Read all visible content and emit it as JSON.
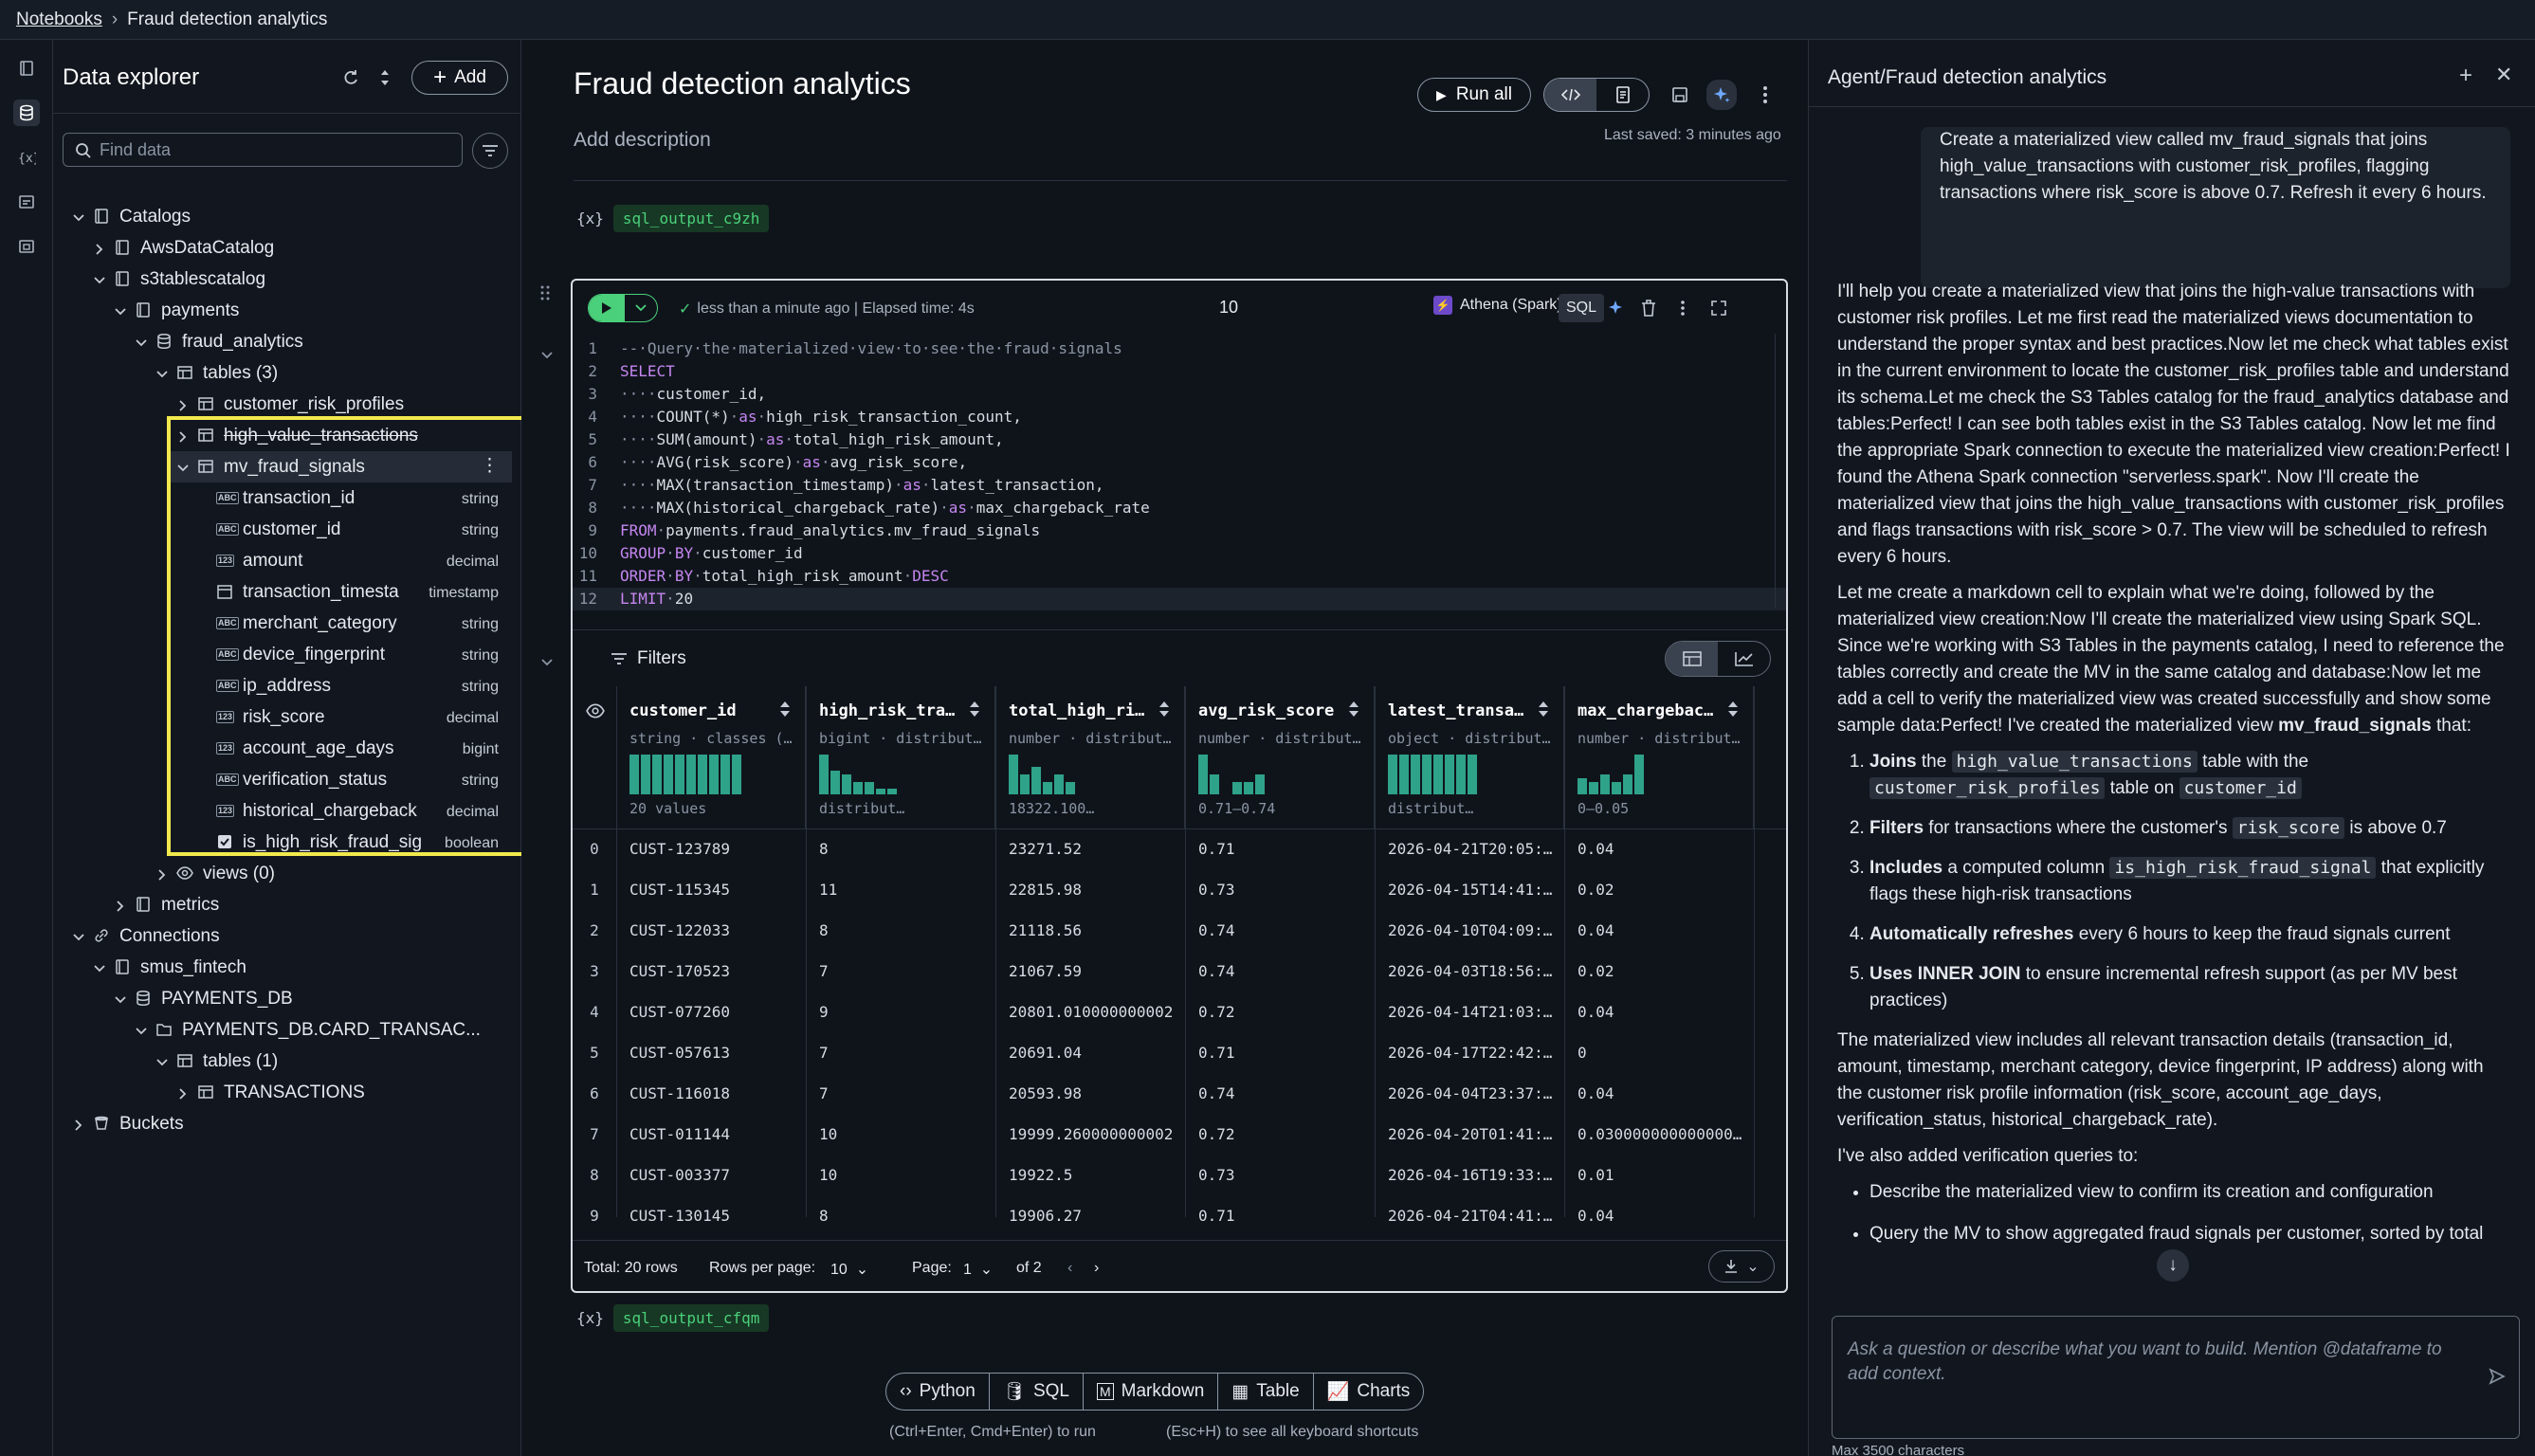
{
  "topbar": {
    "crumb_root": "Notebooks",
    "crumb_current": "Fraud detection analytics"
  },
  "explorer": {
    "title": "Data explorer",
    "add_label": "Add",
    "search_placeholder": "Find data",
    "tree": [
      {
        "label": "Catalogs",
        "icon": "book-icon"
      },
      {
        "label": "AwsDataCatalog",
        "icon": "book-icon"
      },
      {
        "label": "s3tablescatalog",
        "icon": "book-icon"
      },
      {
        "label": "payments",
        "icon": "book-icon"
      },
      {
        "label": "fraud_analytics",
        "icon": "database-icon"
      },
      {
        "label": "tables (3)",
        "icon": "table-icon"
      },
      {
        "label": "customer_risk_profiles",
        "icon": "table-icon"
      },
      {
        "label": "high_value_transactions",
        "icon": "table-icon"
      },
      {
        "label": "mv_fraud_signals",
        "icon": "table-icon"
      },
      {
        "label": "transaction_id",
        "type": "string",
        "badge": "ABC"
      },
      {
        "label": "customer_id",
        "type": "string",
        "badge": "ABC"
      },
      {
        "label": "amount",
        "type": "decimal",
        "badge": "123"
      },
      {
        "label": "transaction_timesta",
        "type": "timestamp",
        "badge": "cal"
      },
      {
        "label": "merchant_category",
        "type": "string",
        "badge": "ABC"
      },
      {
        "label": "device_fingerprint",
        "type": "string",
        "badge": "ABC"
      },
      {
        "label": "ip_address",
        "type": "string",
        "badge": "ABC"
      },
      {
        "label": "risk_score",
        "type": "decimal",
        "badge": "123"
      },
      {
        "label": "account_age_days",
        "type": "bigint",
        "badge": "123"
      },
      {
        "label": "verification_status",
        "type": "string",
        "badge": "ABC"
      },
      {
        "label": "historical_chargeback",
        "type": "decimal",
        "badge": "123"
      },
      {
        "label": "is_high_risk_fraud_sig",
        "type": "boolean",
        "badge": "chk"
      },
      {
        "label": "views (0)",
        "icon": "eye-icon"
      },
      {
        "label": "metrics",
        "icon": "book-icon"
      },
      {
        "label": "Connections",
        "icon": "link-icon"
      },
      {
        "label": "smus_fintech",
        "icon": "book-icon"
      },
      {
        "label": "PAYMENTS_DB",
        "icon": "database-icon"
      },
      {
        "label": "PAYMENTS_DB.CARD_TRANSAC...",
        "icon": "folder-icon"
      },
      {
        "label": "tables (1)",
        "icon": "table-icon"
      },
      {
        "label": "TRANSACTIONS",
        "icon": "table-icon"
      },
      {
        "label": "Buckets",
        "icon": "bucket-icon"
      }
    ]
  },
  "notebook": {
    "title": "Fraud detection analytics",
    "description": "Add description",
    "run_all": "Run all",
    "last_saved": "Last saved: 3 minutes ago",
    "var_above": "sql_output_c9zh",
    "var_below": "sql_output_cfqm",
    "var_brace": "{x}"
  },
  "cell": {
    "status": "less than a minute ago | Elapsed time: 4s",
    "limit": "10",
    "connection": "Athena (Spark)",
    "language": "SQL",
    "code": [
      {
        "n": "1",
        "t": "-- Query the materialized view to see the fraud signals"
      },
      {
        "n": "2",
        "t": "SELECT"
      },
      {
        "n": "3",
        "t": "    customer_id,"
      },
      {
        "n": "4",
        "t": "    COUNT(*) as high_risk_transaction_count,"
      },
      {
        "n": "5",
        "t": "    SUM(amount) as total_high_risk_amount,"
      },
      {
        "n": "6",
        "t": "    AVG(risk_score) as avg_risk_score,"
      },
      {
        "n": "7",
        "t": "    MAX(transaction_timestamp) as latest_transaction,"
      },
      {
        "n": "8",
        "t": "    MAX(historical_chargeback_rate) as max_chargeback_rate"
      },
      {
        "n": "9",
        "t": "FROM payments.fraud_analytics.mv_fraud_signals"
      },
      {
        "n": "10",
        "t": "GROUP BY customer_id"
      },
      {
        "n": "11",
        "t": "ORDER BY total_high_risk_amount DESC"
      },
      {
        "n": "12",
        "t": "LIMIT 20"
      }
    ],
    "filters_label": "Filters",
    "columns": [
      {
        "name": "customer_id",
        "sub": "string · classes (…",
        "cap": "20 values",
        "hist": [
          1,
          1,
          1,
          1,
          1,
          1,
          1,
          1,
          1,
          1
        ]
      },
      {
        "name": "high_risk_tra…",
        "sub": "bigint · distribut…",
        "cap": "distribut…",
        "hist": [
          1,
          0.6,
          0.5,
          0.3,
          0.3,
          0.15,
          0.15
        ]
      },
      {
        "name": "total_high_ri…",
        "sub": "number · distribut…",
        "cap": "18322.100…",
        "hist": [
          1,
          0.5,
          0.7,
          0.3,
          0.5,
          0.3
        ]
      },
      {
        "name": "avg_risk_score",
        "sub": "number · distribut…",
        "cap": "0.71–0.74",
        "hist": [
          1,
          0.5,
          0,
          0.3,
          0.3,
          0.5
        ]
      },
      {
        "name": "latest_transa…",
        "sub": "object · distribut…",
        "cap": "distribut…",
        "hist": [
          1,
          1,
          1,
          1,
          1,
          1,
          1,
          1
        ]
      },
      {
        "name": "max_chargebac…",
        "sub": "number · distribut…",
        "cap": "0–0.05",
        "hist": [
          0.4,
          0.3,
          0.5,
          0.3,
          0.5,
          1
        ]
      }
    ],
    "rows": [
      [
        "0",
        "CUST-123789",
        "8",
        "23271.52",
        "0.71",
        "2026-04-21T20:05:…",
        "0.04"
      ],
      [
        "1",
        "CUST-115345",
        "11",
        "22815.98",
        "0.73",
        "2026-04-15T14:41:…",
        "0.02"
      ],
      [
        "2",
        "CUST-122033",
        "8",
        "21118.56",
        "0.74",
        "2026-04-10T04:09:…",
        "0.04"
      ],
      [
        "3",
        "CUST-170523",
        "7",
        "21067.59",
        "0.74",
        "2026-04-03T18:56:…",
        "0.02"
      ],
      [
        "4",
        "CUST-077260",
        "9",
        "20801.010000000002",
        "0.72",
        "2026-04-14T21:03:…",
        "0.04"
      ],
      [
        "5",
        "CUST-057613",
        "7",
        "20691.04",
        "0.71",
        "2026-04-17T22:42:…",
        "0"
      ],
      [
        "6",
        "CUST-116018",
        "7",
        "20593.98",
        "0.74",
        "2026-04-04T23:37:…",
        "0.04"
      ],
      [
        "7",
        "CUST-011144",
        "10",
        "19999.260000000002",
        "0.72",
        "2026-04-20T01:41:…",
        "0.030000000000000…"
      ],
      [
        "8",
        "CUST-003377",
        "10",
        "19922.5",
        "0.73",
        "2026-04-16T19:33:…",
        "0.01"
      ],
      [
        "9",
        "CUST-130145",
        "8",
        "19906.27",
        "0.71",
        "2026-04-21T04:41:…",
        "0.04"
      ]
    ],
    "pager": {
      "total": "Total: 20 rows",
      "rpp_label": "Rows per page:",
      "rpp": "10",
      "page_label": "Page:",
      "page": "1",
      "of": "of 2"
    }
  },
  "add_cell": {
    "python": "Python",
    "sql": "SQL",
    "markdown": "Markdown",
    "table": "Table",
    "charts": "Charts"
  },
  "hints": {
    "run": "(Ctrl+Enter, Cmd+Enter) to run",
    "shortcuts": "(Esc+H) to see all keyboard shortcuts"
  },
  "agent": {
    "title": "Agent/Fraud detection analytics",
    "user_message": "Create a materialized view called mv_fraud_signals that joins high_value_transactions with customer_risk_profiles, flagging transactions where risk_score is above 0.7. Refresh it every 6 hours.",
    "p1": "I'll help you create a materialized view that joins the high-value transactions with customer risk profiles. Let me first read the materialized views documentation to understand the proper syntax and best practices.Now let me check what tables exist in the current environment to locate the customer_risk_profiles table and understand its schema.Let me check the S3 Tables catalog for the fraud_analytics database and tables:Perfect! I can see both tables exist in the S3 Tables catalog. Now let me find the appropriate Spark connection to execute the materialized view creation:Perfect! I found the Athena Spark connection \"serverless.spark\". Now I'll create the materialized view that joins the high_value_transactions with customer_risk_profiles and flags transactions with risk_score > 0.7. The view will be scheduled to refresh every 6 hours.",
    "p2_pre": "Let me create a markdown cell to explain what we're doing, followed by the materialized view creation:Now I'll create the materialized view using Spark SQL. Since we're working with S3 Tables in the payments catalog, I need to reference the tables correctly and create the MV in the same catalog and database:Now let me add a cell to verify the materialized view was created successfully and show some sample data:Perfect! I've created the materialized view ",
    "p2_bold": "mv_fraud_signals",
    "p2_post": " that:",
    "li1_b": "Joins",
    "li1_a": " the ",
    "li1_c1": "high_value_transactions",
    "li1_m": " table with the ",
    "li1_c2": "customer_risk_profiles",
    "li1_e": " table on ",
    "li1_c3": "customer_id",
    "li2_b": "Filters",
    "li2_a": " for transactions where the customer's ",
    "li2_c": "risk_score",
    "li2_e": " is above 0.7",
    "li3_b": "Includes",
    "li3_a": " a computed column ",
    "li3_c": "is_high_risk_fraud_signal",
    "li3_e": " that explicitly flags these high-risk transactions",
    "li4_b": "Automatically refreshes",
    "li4_e": " every 6 hours to keep the fraud signals current",
    "li5_b": "Uses INNER JOIN",
    "li5_e": " to ensure incremental refresh support (as per MV best practices)",
    "p3": "The materialized view includes all relevant transaction details (transaction_id, amount, timestamp, merchant category, device fingerprint, IP address) along with the customer risk profile information (risk_score, account_age_days, verification_status, historical_chargeback_rate).",
    "p4": "I've also added verification queries to:",
    "b1": "Describe the materialized view to confirm its creation and configuration",
    "b2": "Query the MV to show aggregated fraud signals per customer, sorted by total",
    "input_placeholder": "Ask a question or describe what you want to build. Mention @dataframe to add context.",
    "max_chars": "Max 3500 characters"
  }
}
